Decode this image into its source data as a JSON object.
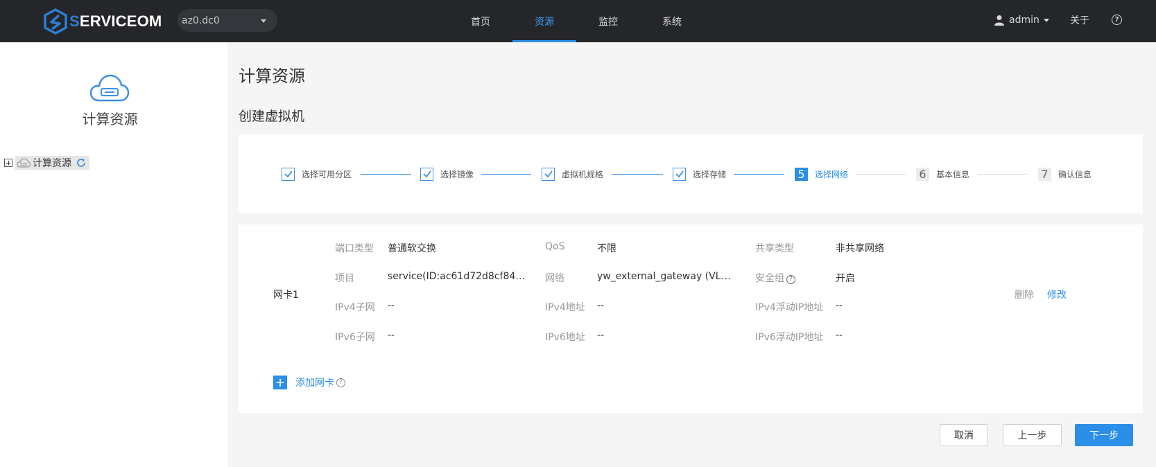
{
  "header": {
    "logo_text_a": "S",
    "logo_text_b": "ERVICE",
    "logo_text_c": "OM",
    "az_select": "az0.dc0",
    "nav": [
      "首页",
      "资源",
      "监控",
      "系统"
    ],
    "active_nav": "资源",
    "user": "admin",
    "about": "关于",
    "help": "?"
  },
  "sidebar": {
    "title": "计算资源",
    "tree_root": "计算资源"
  },
  "main": {
    "page_title": "计算资源",
    "sub_title": "创建虚拟机",
    "steps": [
      {
        "label": "选择可用分区",
        "state": "done"
      },
      {
        "label": "选择镜像",
        "state": "done"
      },
      {
        "label": "虚拟机规格",
        "state": "done"
      },
      {
        "label": "选择存储",
        "state": "done"
      },
      {
        "num": "5",
        "label": "选择网络",
        "state": "current"
      },
      {
        "num": "6",
        "label": "基本信息",
        "state": "todo"
      },
      {
        "num": "7",
        "label": "确认信息",
        "state": "todo"
      }
    ],
    "nic": {
      "name": "网卡1",
      "rows": [
        {
          "l1": "端口类型",
          "v1": "普通软交换",
          "l2": "QoS",
          "v2": "不限",
          "l3": "共享类型",
          "v3": "非共享网络"
        },
        {
          "l1": "项目",
          "v1": "service(ID:ac61d72d8cf84cc3...",
          "l2": "网络",
          "v2": "yw_external_gateway (VLAN I...",
          "l3": "安全组",
          "v3": "开启"
        },
        {
          "l1": "IPv4子网",
          "v1": "--",
          "l2": "IPv4地址",
          "v2": "--",
          "l3": "IPv4浮动IP地址",
          "v3": "--"
        },
        {
          "l1": "IPv6子网",
          "v1": "--",
          "l2": "IPv6地址",
          "v2": "--",
          "l3": "IPv6浮动IP地址",
          "v3": "--"
        }
      ],
      "delete": "删除",
      "edit": "修改"
    },
    "add_nic": "添加网卡",
    "buttons": {
      "cancel": "取消",
      "prev": "上一步",
      "next": "下一步"
    }
  },
  "colors": {
    "accent": "#2b8ee8",
    "topbar": "#24262a",
    "logo_blue": "#2d7fd4"
  }
}
